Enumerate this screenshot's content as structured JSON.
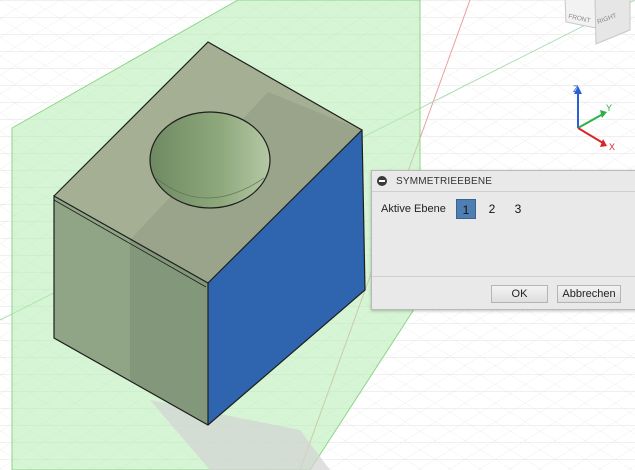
{
  "viewcube": {
    "front_label": "FRONT",
    "right_label": "RIGHT"
  },
  "axes": {
    "x_label": "X",
    "y_label": "Y",
    "z_label": "Z"
  },
  "colors": {
    "plane_fill": "#b5ecb0",
    "plane_edge": "#8fd48a",
    "face_top": "#a4af93",
    "face_left": "#8fa585",
    "face_right": "#2f64ae",
    "axis_x": "#d62828",
    "axis_y": "#2bb04a",
    "axis_z": "#2a5fd6",
    "dialog_active": "#4f7fb2"
  },
  "dialog": {
    "title": "SYMMETRIEEBENE",
    "field_label": "Aktive Ebene",
    "options": [
      "1",
      "2",
      "3"
    ],
    "selected_option": "1",
    "ok_label": "OK",
    "cancel_label": "Abbrechen"
  }
}
